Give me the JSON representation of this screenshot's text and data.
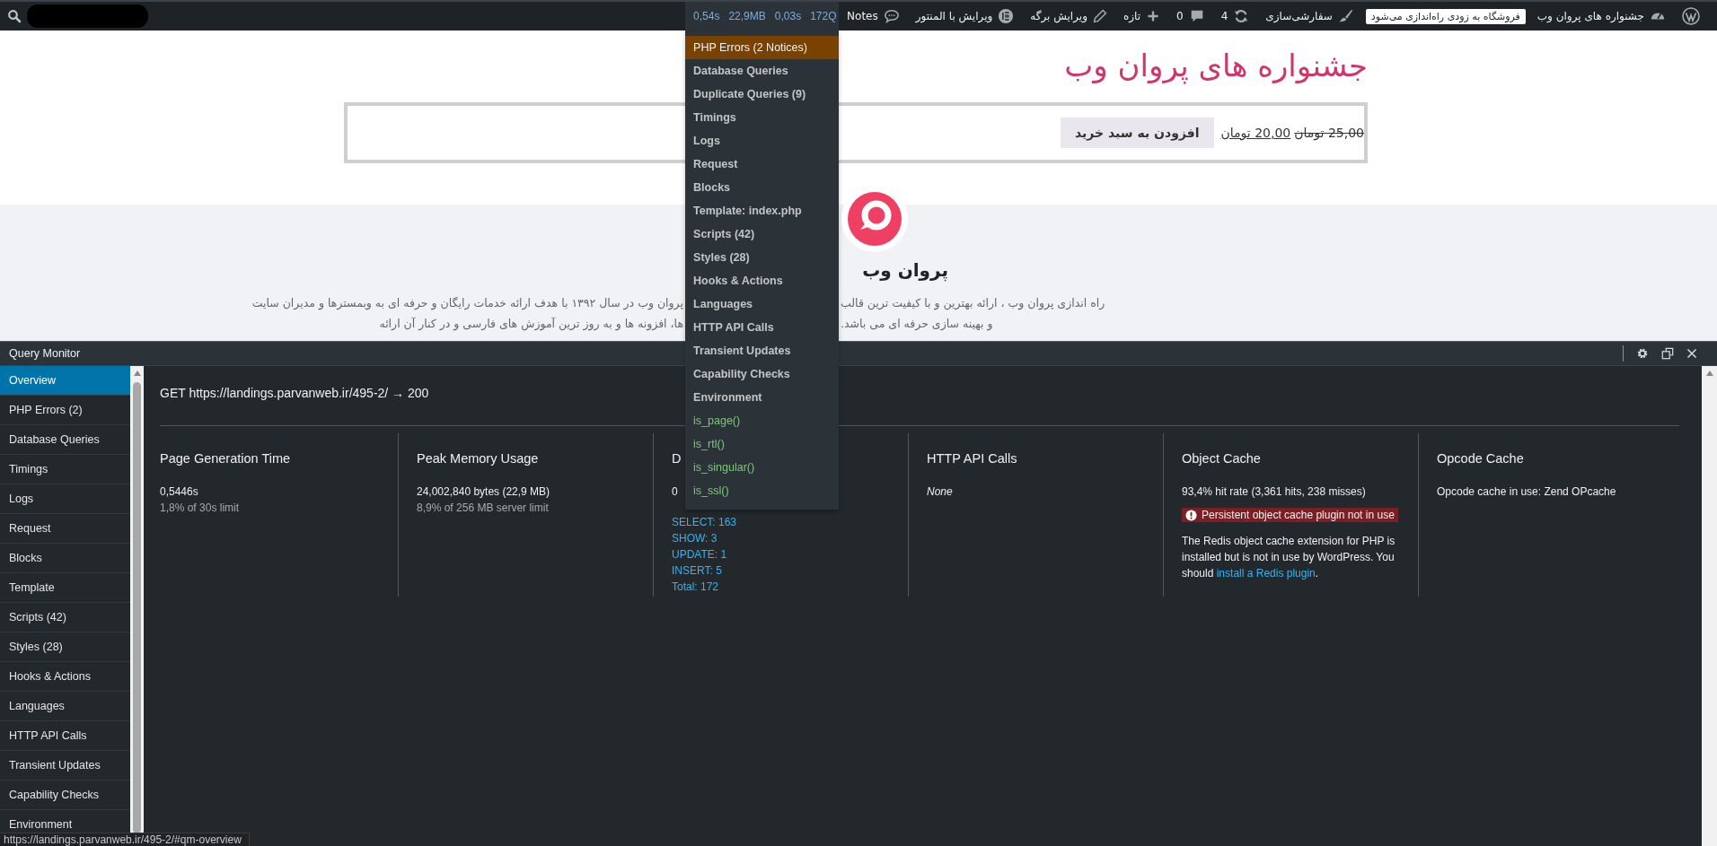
{
  "admin_bar": {
    "items": [
      {
        "kind": "wordpress"
      },
      {
        "kind": "site",
        "label": "جشنواره های پروان وب"
      },
      {
        "kind": "badge",
        "label": "فروشگاه به زودی راه‌اندازی می‌شود"
      },
      {
        "kind": "customize",
        "label": "سفارشی‌سازی"
      },
      {
        "kind": "updates",
        "label": "4"
      },
      {
        "kind": "comments",
        "label": "0"
      },
      {
        "kind": "new",
        "label": "تازه"
      },
      {
        "kind": "edit",
        "label": "ویرایش برگه"
      },
      {
        "kind": "elementor",
        "label": "ویرایش با المنتور"
      },
      {
        "kind": "notes",
        "label": "Notes"
      }
    ],
    "query_monitor": {
      "metrics": [
        "0,54s",
        "22,9MB",
        "0,03s",
        "172Q"
      ],
      "menu": [
        {
          "kind": "warning",
          "label": "PHP Errors (2 Notices)"
        },
        {
          "kind": "panel",
          "label": "Database Queries"
        },
        {
          "kind": "panel",
          "label": "Duplicate Queries (9)"
        },
        {
          "kind": "panel",
          "label": "Timings"
        },
        {
          "kind": "panel",
          "label": "Logs"
        },
        {
          "kind": "panel",
          "label": "Request"
        },
        {
          "kind": "panel",
          "label": "Blocks"
        },
        {
          "kind": "panel",
          "label": "Template: index.php"
        },
        {
          "kind": "panel",
          "label": "Scripts (42)"
        },
        {
          "kind": "panel",
          "label": "Styles (28)"
        },
        {
          "kind": "panel",
          "label": "Hooks & Actions"
        },
        {
          "kind": "panel",
          "label": "Languages"
        },
        {
          "kind": "panel",
          "label": "HTTP API Calls"
        },
        {
          "kind": "panel",
          "label": "Transient Updates"
        },
        {
          "kind": "panel",
          "label": "Capability Checks"
        },
        {
          "kind": "panel",
          "label": "Environment"
        },
        {
          "kind": "condition",
          "label": "is_page()"
        },
        {
          "kind": "condition",
          "label": "is_rtl()"
        },
        {
          "kind": "condition",
          "label": "is_singular()"
        },
        {
          "kind": "condition",
          "label": "is_ssl()"
        }
      ]
    }
  },
  "site": {
    "title": "جشنواره های پروان وب",
    "old_price": "25,00 تومان",
    "sale_price": "20,00 تومان",
    "cart_button": "افزودن به سبد خرید",
    "brand": "پروان وب",
    "paragraph": [
      {
        "left": "پروان وب در سال ۱۳۹۲ با هدف ارائه خدمات رایگان و حرفه ای به وبمسترها و مدیران سایت",
        "right": "راه اندازی پروان وب ، ارائه بهترین و با کیفیت ترین قالب"
      },
      {
        "left": "ها، افزونه ها و به روز ترین آموزش های فارسی و در کنار آن ارائه",
        "right": "و بهینه سازی حرفه ای می باشد."
      }
    ]
  },
  "panel": {
    "title": "Query Monitor",
    "nav": [
      {
        "label": "Overview",
        "selected": true
      },
      {
        "label": "PHP Errors (2)",
        "selected": false
      },
      {
        "label": "Database Queries",
        "selected": false
      },
      {
        "label": "Timings",
        "selected": false
      },
      {
        "label": "Logs",
        "selected": false
      },
      {
        "label": "Request",
        "selected": false
      },
      {
        "label": "Blocks",
        "selected": false
      },
      {
        "label": "Template",
        "selected": false
      },
      {
        "label": "Scripts (42)",
        "selected": false
      },
      {
        "label": "Styles (28)",
        "selected": false
      },
      {
        "label": "Hooks & Actions",
        "selected": false
      },
      {
        "label": "Languages",
        "selected": false
      },
      {
        "label": "HTTP API Calls",
        "selected": false
      },
      {
        "label": "Transient Updates",
        "selected": false
      },
      {
        "label": "Capability Checks",
        "selected": false
      },
      {
        "label": "Environment",
        "selected": false
      }
    ],
    "request": "GET https://landings.parvanweb.ir/495-2/ → 200",
    "columns": [
      {
        "heading": "Page Generation Time",
        "lines": [
          {
            "kind": "value",
            "text": "0,5446s"
          },
          {
            "kind": "muted",
            "text": "1,8% of 30s limit"
          }
        ]
      },
      {
        "heading": "Peak Memory Usage",
        "lines": [
          {
            "kind": "value",
            "text": "24,002,840 bytes (22,9 MB)"
          },
          {
            "kind": "muted",
            "text": "8,9% of 256 MB server limit"
          }
        ]
      },
      {
        "heading": "D",
        "lines": [
          {
            "kind": "value",
            "text": "0"
          },
          {
            "kind": "link",
            "text": "SELECT: 163"
          },
          {
            "kind": "link",
            "text": "SHOW: 3"
          },
          {
            "kind": "link",
            "text": "UPDATE: 1"
          },
          {
            "kind": "link",
            "text": "INSERT: 5"
          },
          {
            "kind": "link",
            "text": "Total: 172"
          }
        ]
      },
      {
        "heading": "HTTP API Calls",
        "lines": [
          {
            "kind": "italic",
            "text": "None"
          }
        ]
      },
      {
        "heading": "Object Cache",
        "lines": [
          {
            "kind": "value",
            "text": "93,4% hit rate (3,361 hits, 238 misses)"
          },
          {
            "kind": "warning",
            "text": "Persistent object cache plugin not in use"
          },
          {
            "kind": "note",
            "text": "The Redis object cache extension for PHP is installed but is not in use by WordPress. You should ",
            "link": "install a Redis plugin",
            "after": "."
          }
        ]
      },
      {
        "heading": "Opcode Cache",
        "lines": [
          {
            "kind": "value",
            "text": "Opcode cache in use: Zend OPcache"
          }
        ]
      }
    ]
  },
  "status_url": "https://landings.parvanweb.ir/495-2/#qm-overview"
}
